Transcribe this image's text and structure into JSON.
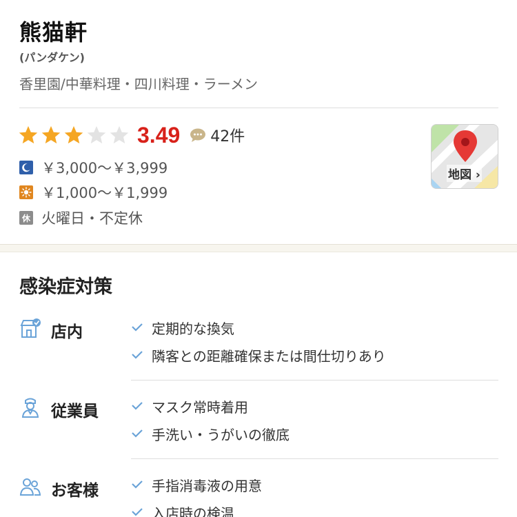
{
  "restaurant": {
    "name": "熊猫軒",
    "kana": "(パンダケン)",
    "genre": "香里園/中華料理・四川料理・ラーメン"
  },
  "rating": {
    "value": "3.49",
    "stars": 3.49,
    "review_count": "42件",
    "star_color": "#f5a623",
    "empty_star_color": "#e3e3e3",
    "value_color": "#d8211a"
  },
  "prices": {
    "dinner": "￥3,000～￥3,999",
    "lunch": "￥1,000～￥1,999"
  },
  "holiday": {
    "icon_label": "休",
    "text": "火曜日・不定休"
  },
  "map": {
    "label": "地図"
  },
  "covid": {
    "title": "感染症対策",
    "categories": [
      {
        "label": "店内",
        "icon": "store-icon",
        "items": [
          "定期的な換気",
          "隣客との距離確保または間仕切りあり"
        ]
      },
      {
        "label": "従業員",
        "icon": "staff-icon",
        "items": [
          "マスク常時着用",
          "手洗い・うがいの徹底"
        ]
      },
      {
        "label": "お客様",
        "icon": "customers-icon",
        "items": [
          "手指消毒液の用意",
          "入店時の検温"
        ]
      }
    ],
    "accent_color": "#6aa3d8"
  }
}
